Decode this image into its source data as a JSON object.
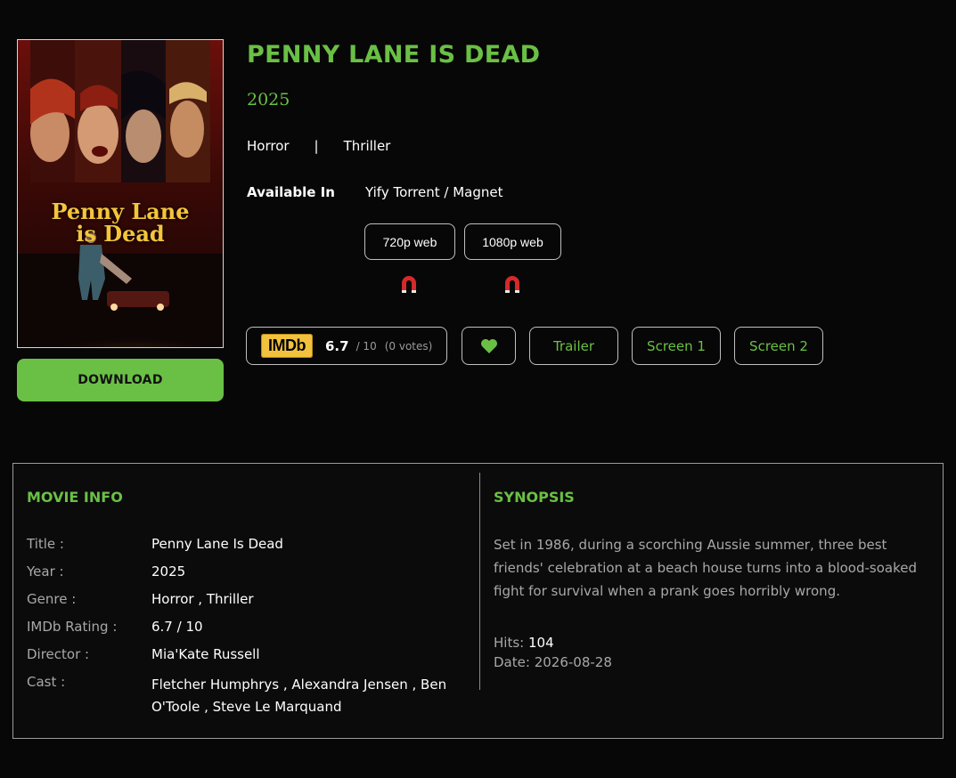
{
  "poster": {
    "title_line1": "Penny Lane",
    "title_line2": "is Dead"
  },
  "download_label": "DOWNLOAD",
  "movie": {
    "title": "PENNY LANE IS DEAD",
    "year": "2025",
    "genres": [
      "Horror",
      "Thriller"
    ],
    "genre_separator": "|"
  },
  "available": {
    "label": "Available In",
    "value": "Yify Torrent / Magnet",
    "qualities": [
      "720p web",
      "1080p web"
    ]
  },
  "imdb": {
    "logo": "IMDb",
    "rating": "6.7",
    "scale": "/ 10",
    "votes": "(0 votes)"
  },
  "actions": {
    "like_icon": "heart-icon",
    "trailer": "Trailer",
    "screen1": "Screen 1",
    "screen2": "Screen 2"
  },
  "movie_info": {
    "heading": "MOVIE INFO",
    "rows": [
      {
        "label": "Title :",
        "value": "Penny Lane Is Dead"
      },
      {
        "label": "Year :",
        "value": "2025"
      },
      {
        "label": "Genre :",
        "value": "Horror , Thriller"
      },
      {
        "label": "IMDb Rating :",
        "value": "6.7 / 10"
      },
      {
        "label": "Director :",
        "value": "Mia'Kate Russell"
      },
      {
        "label": "Cast :",
        "value": "Fletcher Humphrys , Alexandra Jensen , Ben O'Toole , Steve Le Marquand"
      }
    ]
  },
  "synopsis": {
    "heading": "SYNOPSIS",
    "text": "Set in 1986, during a scorching Aussie summer, three best friends' celebration at a beach house turns into a blood-soaked fight for survival when a prank goes horribly wrong.",
    "hits_label": "Hits:",
    "hits_value": "104",
    "date_label": "Date:",
    "date_value": "2026-08-28"
  },
  "colors": {
    "accent": "#6ac045",
    "background": "#070707",
    "imdb_yellow": "#f2c23e",
    "magnet_red": "#d42a2a"
  }
}
